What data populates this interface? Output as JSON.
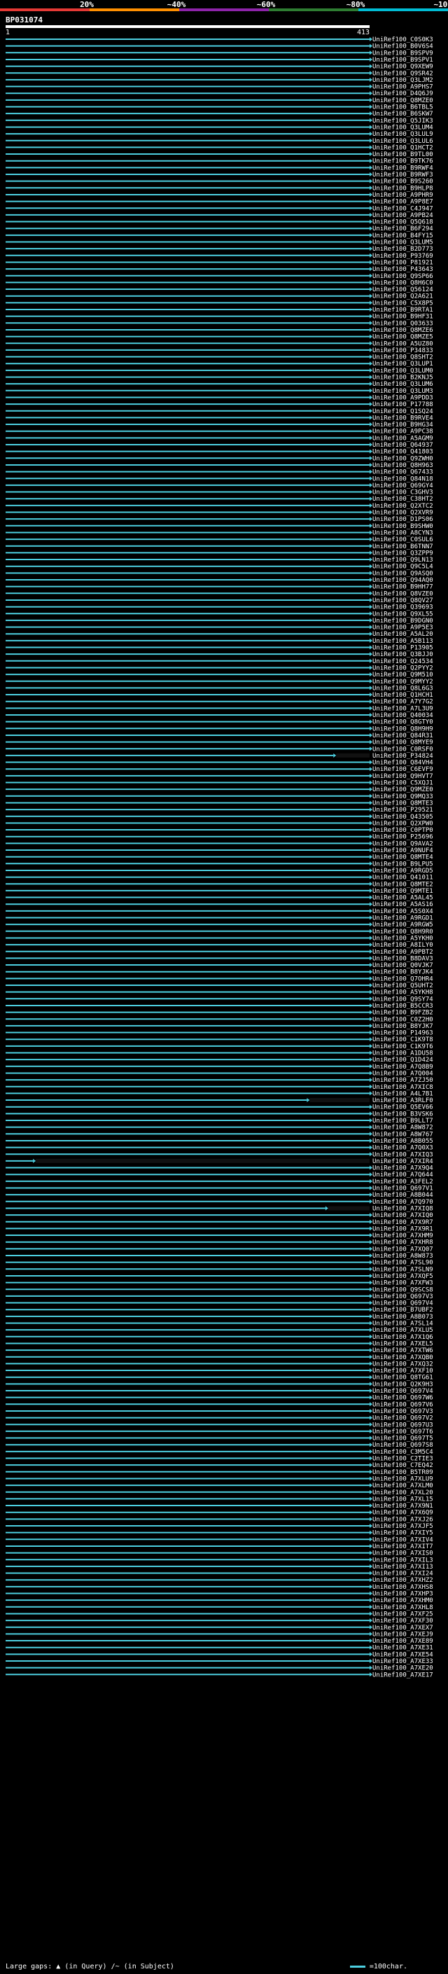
{
  "scale": {
    "labels": [
      "20%",
      "~40%",
      "~60%",
      "~80%",
      "~100%"
    ],
    "colors": [
      "#e53935",
      "#ff8f00",
      "#8e24aa",
      "#2e7d32",
      "#00bcd4"
    ]
  },
  "query": {
    "id": "BP031074",
    "start": "1",
    "end": "413"
  },
  "chart_data": {
    "type": "alignment-overview",
    "query_length": 413,
    "subject_ids": [
      "UniRef100_C0S0K3",
      "UniRef100_B0V6S4",
      "UniRef100_B9SPV9",
      "UniRef100_B9SPV1",
      "UniRef100_Q9XEW9",
      "UniRef100_Q9SR42",
      "UniRef100_Q3LJM2",
      "UniRef100_A9PHS7",
      "UniRef100_D4Q6J9",
      "UniRef100_Q8MZE0",
      "UniRef100_B6TBL5",
      "UniRef100_B6SKW7",
      "UniRef100_Q5JIK3",
      "UniRef100_Q3LUM4",
      "UniRef100_Q3LUL9",
      "UniRef100_Q3LUL6",
      "UniRef100_Q1HCT2",
      "UniRef100_B9TL00",
      "UniRef100_B9TK76",
      "UniRef100_B9RWF4",
      "UniRef100_B9RWF3",
      "UniRef100_B9S260",
      "UniRef100_B9HLP8",
      "UniRef100_A9PHR9",
      "UniRef100_A9P8E7",
      "UniRef100_C4J947",
      "UniRef100_A9PB24",
      "UniRef100_Q5Q618",
      "UniRef100_B6F294",
      "UniRef100_B4FY15",
      "UniRef100_Q3LUM5",
      "UniRef100_B2D773",
      "UniRef100_P93769",
      "UniRef100_P81921",
      "UniRef100_P43643",
      "UniRef100_Q9SP66",
      "UniRef100_Q8H6C0",
      "UniRef100_Q56124",
      "UniRef100_Q2A621",
      "UniRef100_C5X8P5",
      "UniRef100_B9RTA1",
      "UniRef100_B9HF31",
      "UniRef100_Q03633",
      "UniRef100_Q8MZE6",
      "UniRef100_Q8MZE5",
      "UniRef100_A5UZ80",
      "UniRef100_P34833",
      "UniRef100_Q8SHT2",
      "UniRef100_Q3LUP1",
      "UniRef100_Q3LUM0",
      "UniRef100_B2KNJ5",
      "UniRef100_Q3LUM6",
      "UniRef100_Q3LUM3",
      "UniRef100_A9PDD3",
      "UniRef100_P17788",
      "UniRef100_Q1SQ24",
      "UniRef100_B9RVE4",
      "UniRef100_B9HG34",
      "UniRef100_A9PC38",
      "UniRef100_A5AGM9",
      "UniRef100_Q64937",
      "UniRef100_Q41803",
      "UniRef100_Q9ZWH0",
      "UniRef100_Q8H963",
      "UniRef100_Q67433",
      "UniRef100_Q84N18",
      "UniRef100_Q69GY4",
      "UniRef100_C3GHV3",
      "UniRef100_C38HT2",
      "UniRef100_Q2XTC2",
      "UniRef100_Q2XVR9",
      "UniRef100_D1PS06",
      "UniRef100_B9SHW0",
      "UniRef100_A8CYN3",
      "UniRef100_C0SUL6",
      "UniRef100_B6TNN7",
      "UniRef100_Q3ZPP9",
      "UniRef100_Q9LN13",
      "UniRef100_Q9C5L4",
      "UniRef100_Q9ASQ0",
      "UniRef100_Q94AQ0",
      "UniRef100_B9HH77",
      "UniRef100_Q8VZE0",
      "UniRef100_Q8QV27",
      "UniRef100_Q39693",
      "UniRef100_Q9XL55",
      "UniRef100_B9DGN0",
      "UniRef100_A9P5E3",
      "UniRef100_A5AL20",
      "UniRef100_A5B113",
      "UniRef100_P13905",
      "UniRef100_Q3BJJ0",
      "UniRef100_Q24534",
      "UniRef100_Q2PYY2",
      "UniRef100_Q9M510",
      "UniRef100_Q9MYY2",
      "UniRef100_Q8L6G3",
      "UniRef100_Q1HCH1",
      "UniRef100_A7Y7G2",
      "UniRef100_A7L3U9",
      "UniRef100_Q40034",
      "UniRef100_Q8GTY0",
      "UniRef100_Q8H9H9",
      "UniRef100_Q84R31",
      "UniRef100_Q8MYE9",
      "UniRef100_C0RSF0",
      "UniRef100_P34824",
      "UniRef100_Q84VH4",
      "UniRef100_C6EVF9",
      "UniRef100_Q9HVT7",
      "UniRef100_C5XQJ1",
      "UniRef100_Q9MZE0",
      "UniRef100_Q9MQ33",
      "UniRef100_Q8MTE3",
      "UniRef100_P29521",
      "UniRef100_Q43505",
      "UniRef100_Q2XPW0",
      "UniRef100_C0PTP0",
      "UniRef100_P25696",
      "UniRef100_Q9AVA2",
      "UniRef100_A9NUF4",
      "UniRef100_Q8MTE4",
      "UniRef100_B9LPU5",
      "UniRef100_A9RGD5",
      "UniRef100_Q41011",
      "UniRef100_Q8MTE2",
      "UniRef100_Q9MTE1",
      "UniRef100_A5AL45",
      "UniRef100_A5AS16",
      "UniRef100_A5S0X4",
      "UniRef100_A9RGD1",
      "UniRef100_A9RGW5",
      "UniRef100_Q8H9R0",
      "UniRef100_A5YKH0",
      "UniRef100_A8ILY0",
      "UniRef100_A9PBT2",
      "UniRef100_B8DAV3",
      "UniRef100_Q0VJK7",
      "UniRef100_B8YJK4",
      "UniRef100_Q7OHR4",
      "UniRef100_Q5UHT2",
      "UniRef100_A5YKH8",
      "UniRef100_Q9SY74",
      "UniRef100_B5CCR3",
      "UniRef100_B9FZB2",
      "UniRef100_C0Z2H0",
      "UniRef100_B8YJK7",
      "UniRef100_P14963",
      "UniRef100_C1K9T8",
      "UniRef100_C1K9T6",
      "UniRef100_A1DU58",
      "UniRef100_Q1D424",
      "UniRef100_A7Q8B9",
      "UniRef100_A7Q004",
      "UniRef100_A7ZJ50",
      "UniRef100_A7XIC8",
      "UniRef100_A4L7B1",
      "UniRef100_A3RLF0",
      "UniRef100_Q5EV66",
      "UniRef100_B3VSK6",
      "UniRef100_B9LLT7",
      "UniRef100_A8W872",
      "UniRef100_A8W767",
      "UniRef100_A8B055",
      "UniRef100_A7Q0X3",
      "UniRef100_A7XIQ3",
      "UniRef100_A7XIR4",
      "UniRef100_A7X9Q4",
      "UniRef100_A7Q644",
      "UniRef100_A3FEL2",
      "UniRef100_Q697V1",
      "UniRef100_A8B044",
      "UniRef100_A7Q970",
      "UniRef100_A7XIQ8",
      "UniRef100_A7XIQ0",
      "UniRef100_A7X9R7",
      "UniRef100_A7X9R1",
      "UniRef100_A7XHM9",
      "UniRef100_A7XHR8",
      "UniRef100_A7XQ07",
      "UniRef100_A8W873",
      "UniRef100_A7SL90",
      "UniRef100_A7SLN9",
      "UniRef100_A7XQF5",
      "UniRef100_A7XFW3",
      "UniRef100_Q9SCS8",
      "UniRef100_Q697V3",
      "UniRef100_Q697V4",
      "UniRef100_B7UBF2",
      "UniRef100_A8B073",
      "UniRef100_A7SL14",
      "UniRef100_A7XLU5",
      "UniRef100_A7X1Q6",
      "UniRef100_A7XEL5",
      "UniRef100_A7XTW6",
      "UniRef100_A7XQB0",
      "UniRef100_A7XQ32",
      "UniRef100_A7XF10",
      "UniRef100_Q8TG61",
      "UniRef100_Q2K9H3",
      "UniRef100_Q697V4",
      "UniRef100_Q697W6",
      "UniRef100_Q697V6",
      "UniRef100_Q697V3",
      "UniRef100_Q697V2",
      "UniRef100_Q697U3",
      "UniRef100_Q697T6",
      "UniRef100_Q697T5",
      "UniRef100_Q697S8",
      "UniRef100_C3M5C4",
      "UniRef100_C2TIE3",
      "UniRef100_C7EQ42",
      "UniRef100_B5TR09",
      "UniRef100_A7XLU9",
      "UniRef100_A7XLM0",
      "UniRef100_A7XL20",
      "UniRef100_A7XL15",
      "UniRef100_A7X9N1",
      "UniRef100_A7X6Q9",
      "UniRef100_A7XJ26",
      "UniRef100_A7XJF5",
      "UniRef100_A7XIY5",
      "UniRef100_A7XIV4",
      "UniRef100_A7XIT7",
      "UniRef100_A7XIS0",
      "UniRef100_A7XIL3",
      "UniRef100_A7XI13",
      "UniRef100_A7XI24",
      "UniRef100_A7XHZ2",
      "UniRef100_A7XHS8",
      "UniRef100_A7XHP3",
      "UniRef100_A7XHM0",
      "UniRef100_A7XHL8",
      "UniRef100_A7XF25",
      "UniRef100_A7XF30",
      "UniRef100_A7XEX7",
      "UniRef100_A7XEJ9",
      "UniRef100_A7XE89",
      "UniRef100_A7XE31",
      "UniRef100_A7XE54",
      "UniRef100_A7XE33",
      "UniRef100_A7XE20",
      "UniRef100_A7XE17"
    ],
    "partial_hits": [
      {
        "row": 106,
        "q_start": 1,
        "q_end": 372
      },
      {
        "row": 157,
        "q_start": 1,
        "q_end": 342
      },
      {
        "row": 166,
        "q_start": 1,
        "q_end": 32
      },
      {
        "row": 173,
        "q_start": 1,
        "q_end": 363
      }
    ],
    "full_hit": {
      "q_start": 1,
      "q_end": 413
    }
  },
  "footer": {
    "large_gaps_label": "Large gaps:",
    "in_query": "(in Query)",
    "in_subject": "(in Subject)",
    "scale_note": "=100char."
  }
}
